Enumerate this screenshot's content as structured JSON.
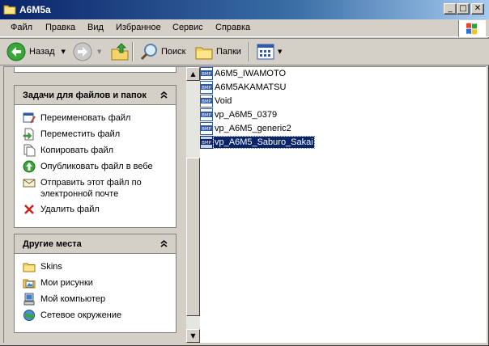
{
  "window": {
    "title": "A6M5a"
  },
  "titlebar_buttons": {
    "minimize": "_",
    "maximize": "□",
    "close": "✕"
  },
  "menu": [
    {
      "label": "Файл"
    },
    {
      "label": "Правка"
    },
    {
      "label": "Вид"
    },
    {
      "label": "Избранное"
    },
    {
      "label": "Сервис"
    },
    {
      "label": "Справка"
    }
  ],
  "toolbar": {
    "back_label": "Назад",
    "search_label": "Поиск",
    "folders_label": "Папки",
    "view_icon": "views-icon"
  },
  "tasks_panel": {
    "title": "Задачи для файлов и папок",
    "collapse": "«",
    "items": [
      {
        "label": "Переименовать файл",
        "icon": "rename-icon"
      },
      {
        "label": "Переместить файл",
        "icon": "move-icon"
      },
      {
        "label": "Копировать файл",
        "icon": "copy-icon"
      },
      {
        "label": "Опубликовать файл в вебе",
        "icon": "publish-web-icon"
      },
      {
        "label": "Отправить этот файл по электронной почте",
        "icon": "email-icon"
      },
      {
        "label": "Удалить файл",
        "icon": "delete-icon"
      }
    ]
  },
  "places_panel": {
    "title": "Другие места",
    "collapse": "«",
    "items": [
      {
        "label": "Skins",
        "icon": "folder-icon"
      },
      {
        "label": "Мои рисунки",
        "icon": "my-pictures-icon"
      },
      {
        "label": "Мой компьютер",
        "icon": "my-computer-icon"
      },
      {
        "label": "Сетевое окружение",
        "icon": "network-icon"
      }
    ]
  },
  "files": [
    {
      "name": "A6M5_IWAMOTO",
      "icon": "bmp-file-icon",
      "selected": false
    },
    {
      "name": "A6M5AKAMATSU",
      "icon": "bmp-file-icon",
      "selected": false
    },
    {
      "name": "Void",
      "icon": "bmp-file-icon",
      "selected": false
    },
    {
      "name": "vp_A6M5_0379",
      "icon": "bmp-file-icon",
      "selected": false
    },
    {
      "name": "vp_A6M5_generic2",
      "icon": "bmp-file-icon",
      "selected": false
    },
    {
      "name": "vp_A6M5_Saburo_Sakai",
      "icon": "bmp-file-icon",
      "selected": true
    }
  ],
  "bmp_badge": "BMP",
  "colors": {
    "selection": "#0a246a",
    "titlebar": "#0a246a",
    "face": "#d4d0c8"
  }
}
